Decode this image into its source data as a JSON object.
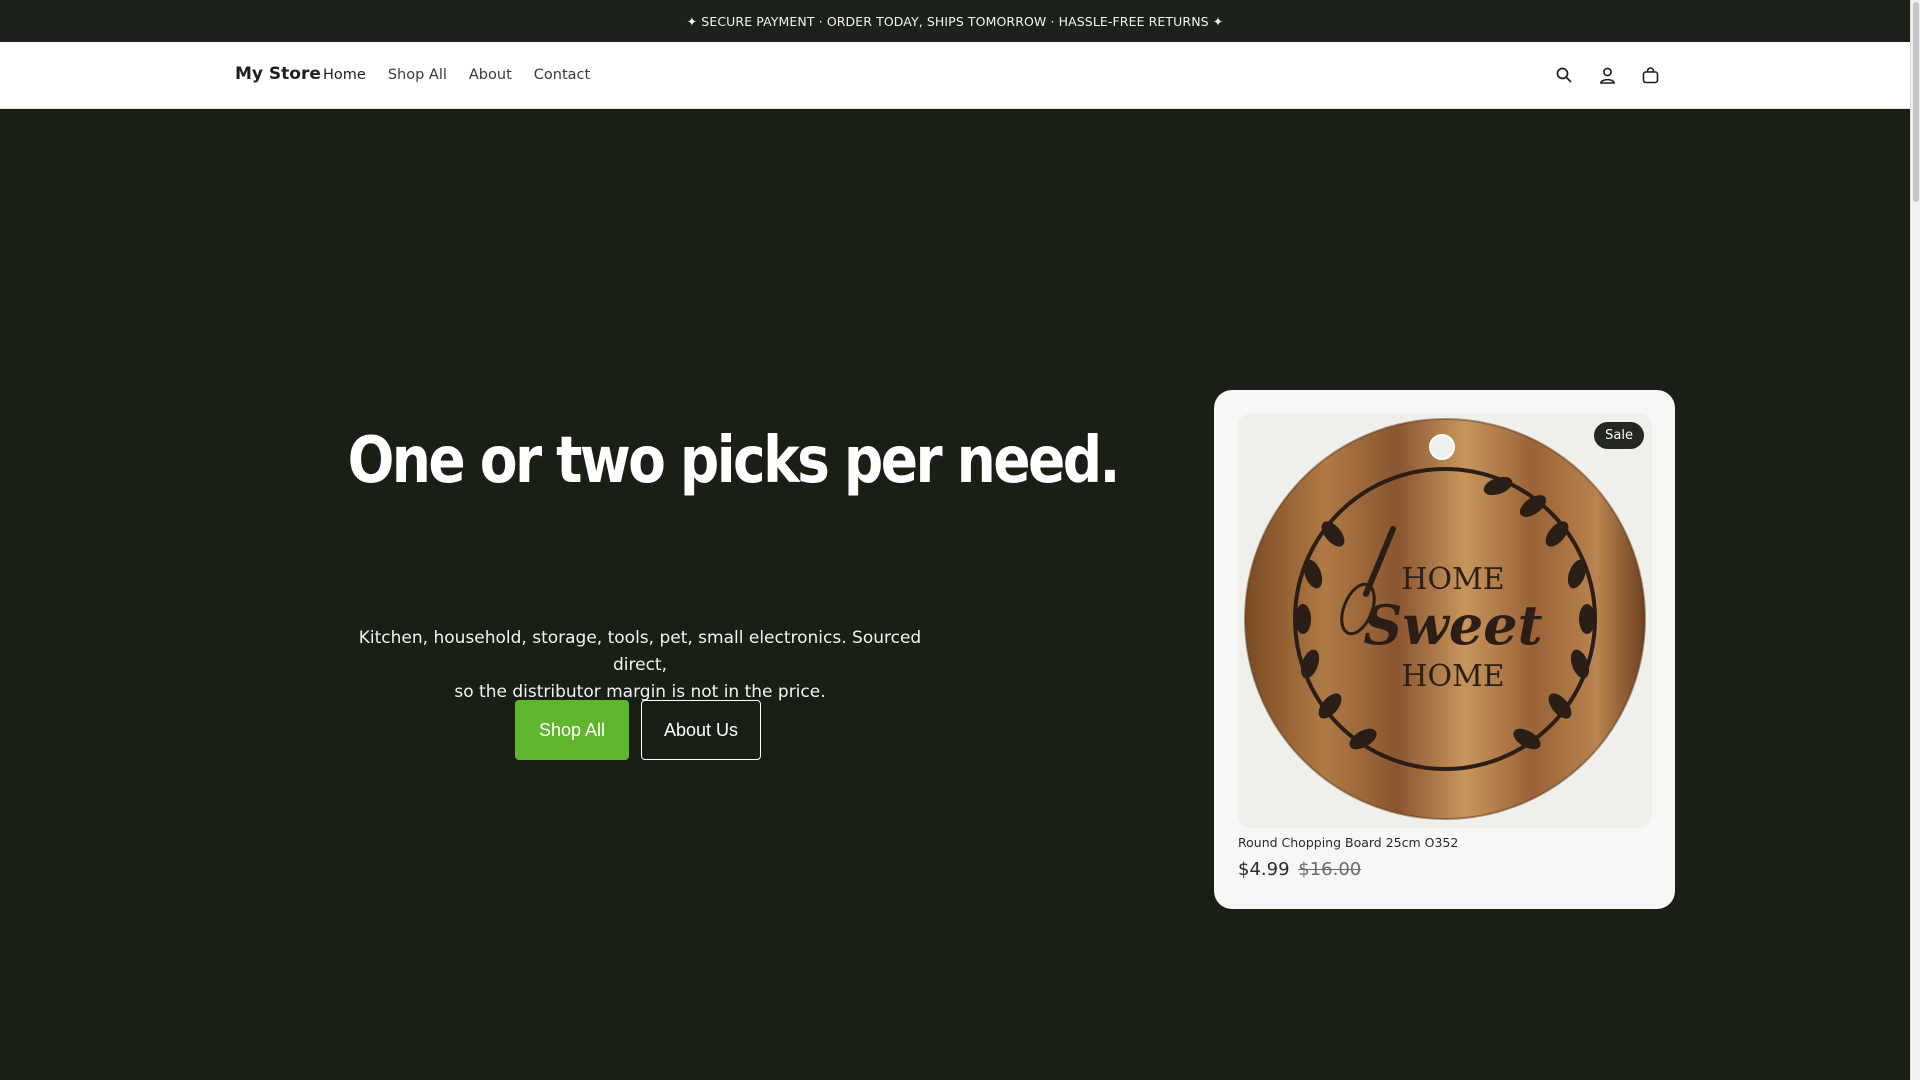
{
  "announcement": "✦ SECURE PAYMENT · ORDER TODAY, SHIPS TOMORROW · HASSLE-FREE RETURNS ✦",
  "header": {
    "brand": "My Store",
    "nav": [
      "Home",
      "Shop All",
      "About",
      "Contact"
    ],
    "icons": [
      "search-icon",
      "account-icon",
      "cart-icon"
    ]
  },
  "hero": {
    "headline": "One or two picks per need.",
    "subtitle_line1": "Kitchen, household, storage, tools, pet, small electronics. Sourced direct,",
    "subtitle_line2": "so the distributor margin is not in the price.",
    "primary_button": "Shop All",
    "secondary_button": "About Us"
  },
  "product": {
    "badge": "Sale",
    "name": "Round Chopping Board 25cm O352",
    "price": "$4.99",
    "compare_price": "$16.00",
    "image_text": [
      "HOME",
      "Sweet",
      "HOME"
    ]
  },
  "colors": {
    "hero_bg": "#1a1f16",
    "accent": "#5fb52b",
    "card_bg": "#f7f8f6"
  }
}
